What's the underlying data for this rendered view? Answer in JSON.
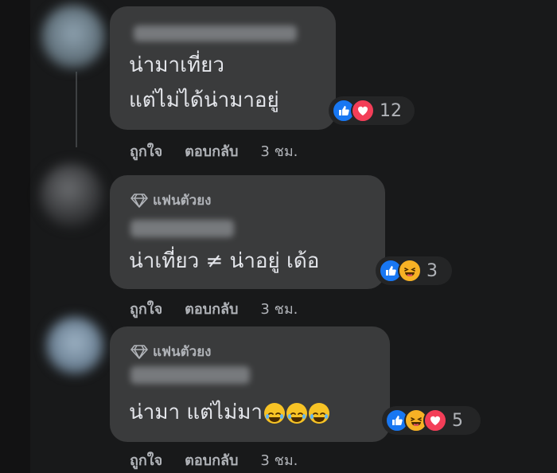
{
  "comments": [
    {
      "text_lines": [
        "น่ามาเที่ยว",
        "แต่ไม่ได้น่ามาอยู่"
      ],
      "reactions": [
        "like",
        "love"
      ],
      "reaction_count": "12",
      "actions": {
        "like": "ถูกใจ",
        "reply": "ตอบกลับ",
        "time": "3 ชม."
      }
    },
    {
      "badge": "แฟนตัวยง",
      "text": "น่าเที่ยว ≠ น่าอยู่ เด้อ",
      "reactions": [
        "like",
        "haha"
      ],
      "reaction_count": "3",
      "actions": {
        "like": "ถูกใจ",
        "reply": "ตอบกลับ",
        "time": "3 ชม."
      }
    },
    {
      "badge": "แฟนตัวยง",
      "text": "น่ามา แต่ไม่มา",
      "inline_emojis": [
        "tears-of-joy",
        "tears-of-joy",
        "tears-of-joy"
      ],
      "reactions": [
        "like",
        "haha",
        "love"
      ],
      "reaction_count": "5",
      "actions": {
        "like": "ถูกใจ",
        "reply": "ตอบกลับ",
        "time": "3 ชม."
      }
    }
  ],
  "colors": {
    "background": "#18191a",
    "bubble": "#3a3b3c",
    "text": "#e4e6eb",
    "secondary_text": "#b0b3b8",
    "like_blue": "#1877f2",
    "love_red": "#f33e58",
    "haha_yellow": "#f7b125"
  }
}
